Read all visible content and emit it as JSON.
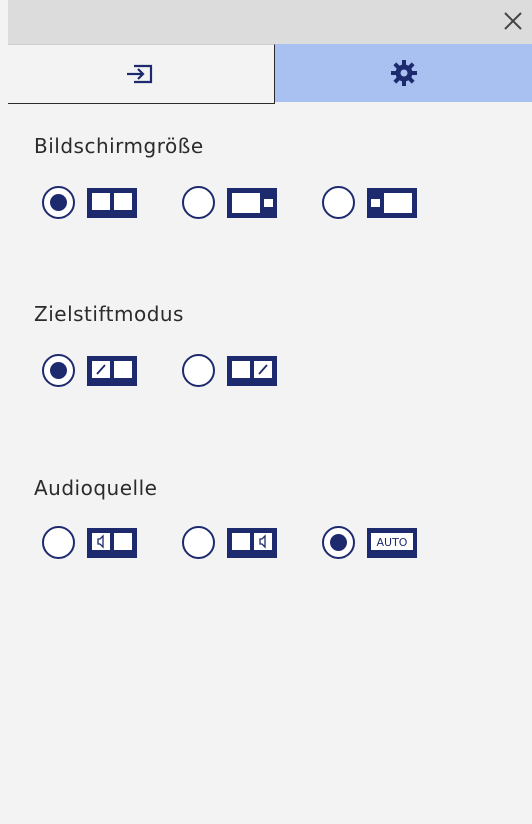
{
  "window": {
    "close_icon": "close-icon"
  },
  "tabs": [
    {
      "id": "input",
      "icon": "input-source-icon",
      "active": false
    },
    {
      "id": "settings",
      "icon": "gear-icon",
      "active": true
    }
  ],
  "sections": {
    "screen_size": {
      "title": "Bildschirmgröße",
      "options": [
        {
          "icon": "split-equal-icon",
          "selected": true
        },
        {
          "icon": "split-left-large-icon",
          "selected": false
        },
        {
          "icon": "split-right-large-icon",
          "selected": false
        }
      ]
    },
    "pen_mode": {
      "title": "Zielstiftmodus",
      "options": [
        {
          "icon": "pen-left-icon",
          "selected": true
        },
        {
          "icon": "pen-right-icon",
          "selected": false
        }
      ]
    },
    "audio_source": {
      "title": "Audioquelle",
      "auto_label": "AUTO",
      "options": [
        {
          "icon": "audio-left-icon",
          "selected": false
        },
        {
          "icon": "audio-right-icon",
          "selected": false
        },
        {
          "icon": "audio-auto-icon",
          "selected": true
        }
      ]
    }
  },
  "colors": {
    "accent": "#1d2a6e",
    "active_tab": "#a9c1f0",
    "background": "#f3f3f3"
  }
}
